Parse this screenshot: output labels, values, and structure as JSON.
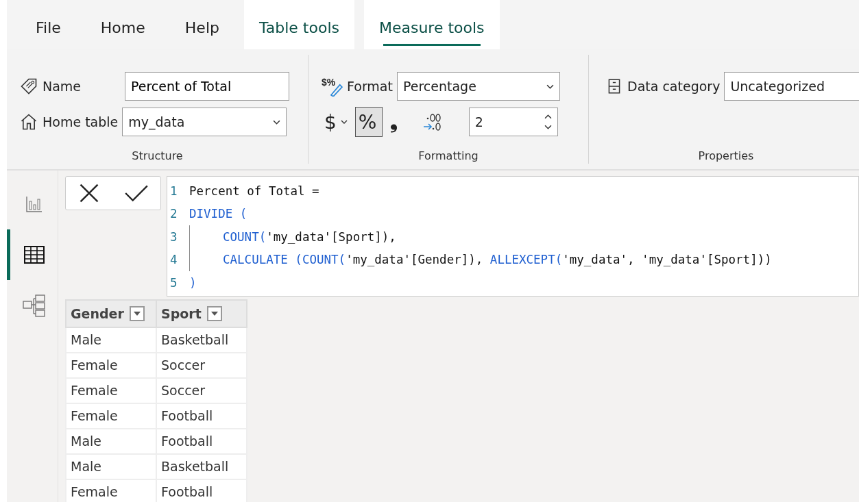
{
  "tabs": [
    {
      "label": "File",
      "kind": "plain",
      "selected": false
    },
    {
      "label": "Home",
      "kind": "plain",
      "selected": false
    },
    {
      "label": "Help",
      "kind": "plain",
      "selected": false
    },
    {
      "label": "Table tools",
      "kind": "contextual",
      "selected": false
    },
    {
      "label": "Measure tools",
      "kind": "contextual",
      "selected": true
    }
  ],
  "structure": {
    "group_label": "Structure",
    "name_label": "Name",
    "name_value": "Percent of Total",
    "home_table_label": "Home table",
    "home_table_value": "my_data"
  },
  "formatting": {
    "group_label": "Formatting",
    "format_icon": "$%",
    "format_label": "Format",
    "format_value": "Percentage",
    "decimals_value": "2",
    "buttons": [
      {
        "kind": "currency",
        "label": "$",
        "selected": false
      },
      {
        "kind": "percent",
        "label": "%",
        "selected": true
      },
      {
        "kind": "comma",
        "label": "❟",
        "selected": false
      },
      {
        "kind": "decimal",
        "selected": false
      }
    ]
  },
  "properties": {
    "group_label": "Properties",
    "data_category_label": "Data category",
    "data_category_value": "Uncategorized"
  },
  "nav": [
    {
      "kind": "report",
      "selected": false
    },
    {
      "kind": "table",
      "selected": true
    },
    {
      "kind": "model",
      "selected": false
    }
  ],
  "formula": {
    "lines": [
      {
        "number": "1",
        "indent": false,
        "tokens": [
          {
            "kind": "text",
            "text": "Percent of Total ="
          }
        ]
      },
      {
        "number": "2",
        "indent": false,
        "tokens": [
          {
            "kind": "keyword",
            "text": "DIVIDE ("
          }
        ]
      },
      {
        "number": "3",
        "indent": true,
        "tokens": [
          {
            "kind": "keyword",
            "text": "COUNT("
          },
          {
            "kind": "text",
            "text": "'my_data'[Sport]"
          },
          {
            "kind": "text",
            "text": "),"
          }
        ]
      },
      {
        "number": "4",
        "indent": true,
        "tokens": [
          {
            "kind": "keyword",
            "text": "CALCULATE (COUNT("
          },
          {
            "kind": "text",
            "text": "'my_data'[Gender]"
          },
          {
            "kind": "text",
            "text": "), "
          },
          {
            "kind": "keyword",
            "text": "ALLEXCEPT("
          },
          {
            "kind": "text",
            "text": "'my_data', 'my_data'[Sport]"
          },
          {
            "kind": "text",
            "text": "))"
          }
        ]
      },
      {
        "number": "5",
        "indent": false,
        "tokens": [
          {
            "kind": "keyword",
            "text": ")"
          }
        ]
      }
    ]
  },
  "table": {
    "columns": [
      "Gender",
      "Sport"
    ],
    "rows": [
      [
        "Male",
        "Basketball"
      ],
      [
        "Female",
        "Soccer"
      ],
      [
        "Female",
        "Soccer"
      ],
      [
        "Female",
        "Football"
      ],
      [
        "Male",
        "Football"
      ],
      [
        "Male",
        "Basketball"
      ],
      [
        "Female",
        "Football"
      ]
    ]
  }
}
